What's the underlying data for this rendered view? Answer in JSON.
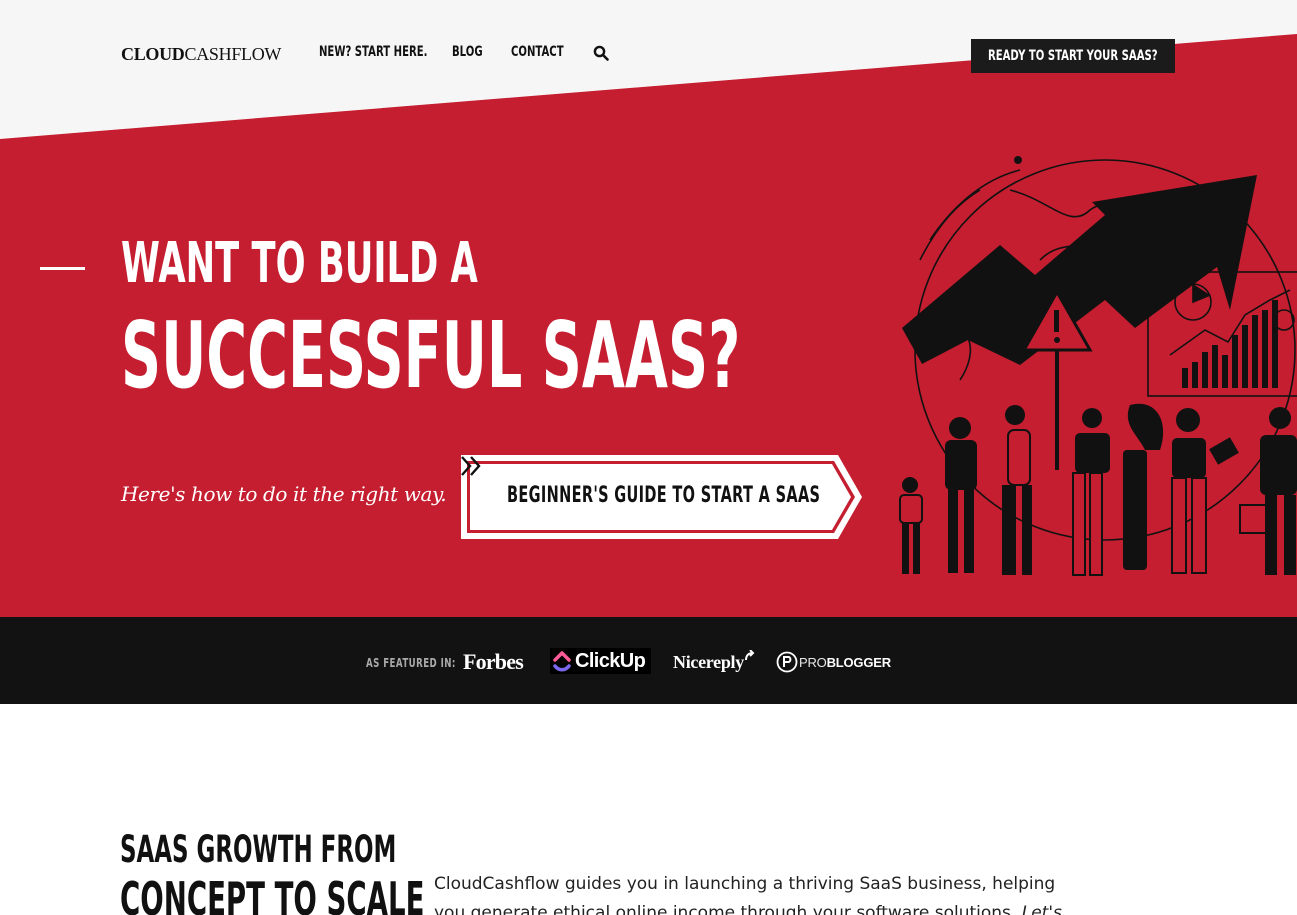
{
  "header": {
    "logo_bold": "CLOUD",
    "logo_light": "CASHFLOW",
    "nav": [
      "NEW? START HERE.",
      "BLOG",
      "CONTACT"
    ],
    "cta": "READY TO START YOUR SAAS?"
  },
  "hero": {
    "heading_line1": "WANT TO BUILD A",
    "heading_line2": "SUCCESSFUL SAAS?",
    "tagline": "Here's how to do it the right way.",
    "button_label": "BEGINNER'S GUIDE TO START A SAAS"
  },
  "featured": {
    "label": "AS FEATURED IN:",
    "logos": {
      "forbes": "Forbes",
      "clickup": "ClickUp",
      "nicereply": "Nicereply",
      "problogger_thin": "PRO",
      "problogger_bold": "BLOGGER"
    }
  },
  "intro": {
    "heading_line1": "SAAS GROWTH FROM",
    "heading_line2": "CONCEPT TO SCALE",
    "body": "CloudCashflow guides you in launching a thriving SaaS business, helping you generate ethical online income through your software solutions.",
    "body_italic": "Let's get started."
  },
  "colors": {
    "hero_red": "#c41e30",
    "header_bg": "#f7f6f7",
    "dark": "#121212"
  }
}
